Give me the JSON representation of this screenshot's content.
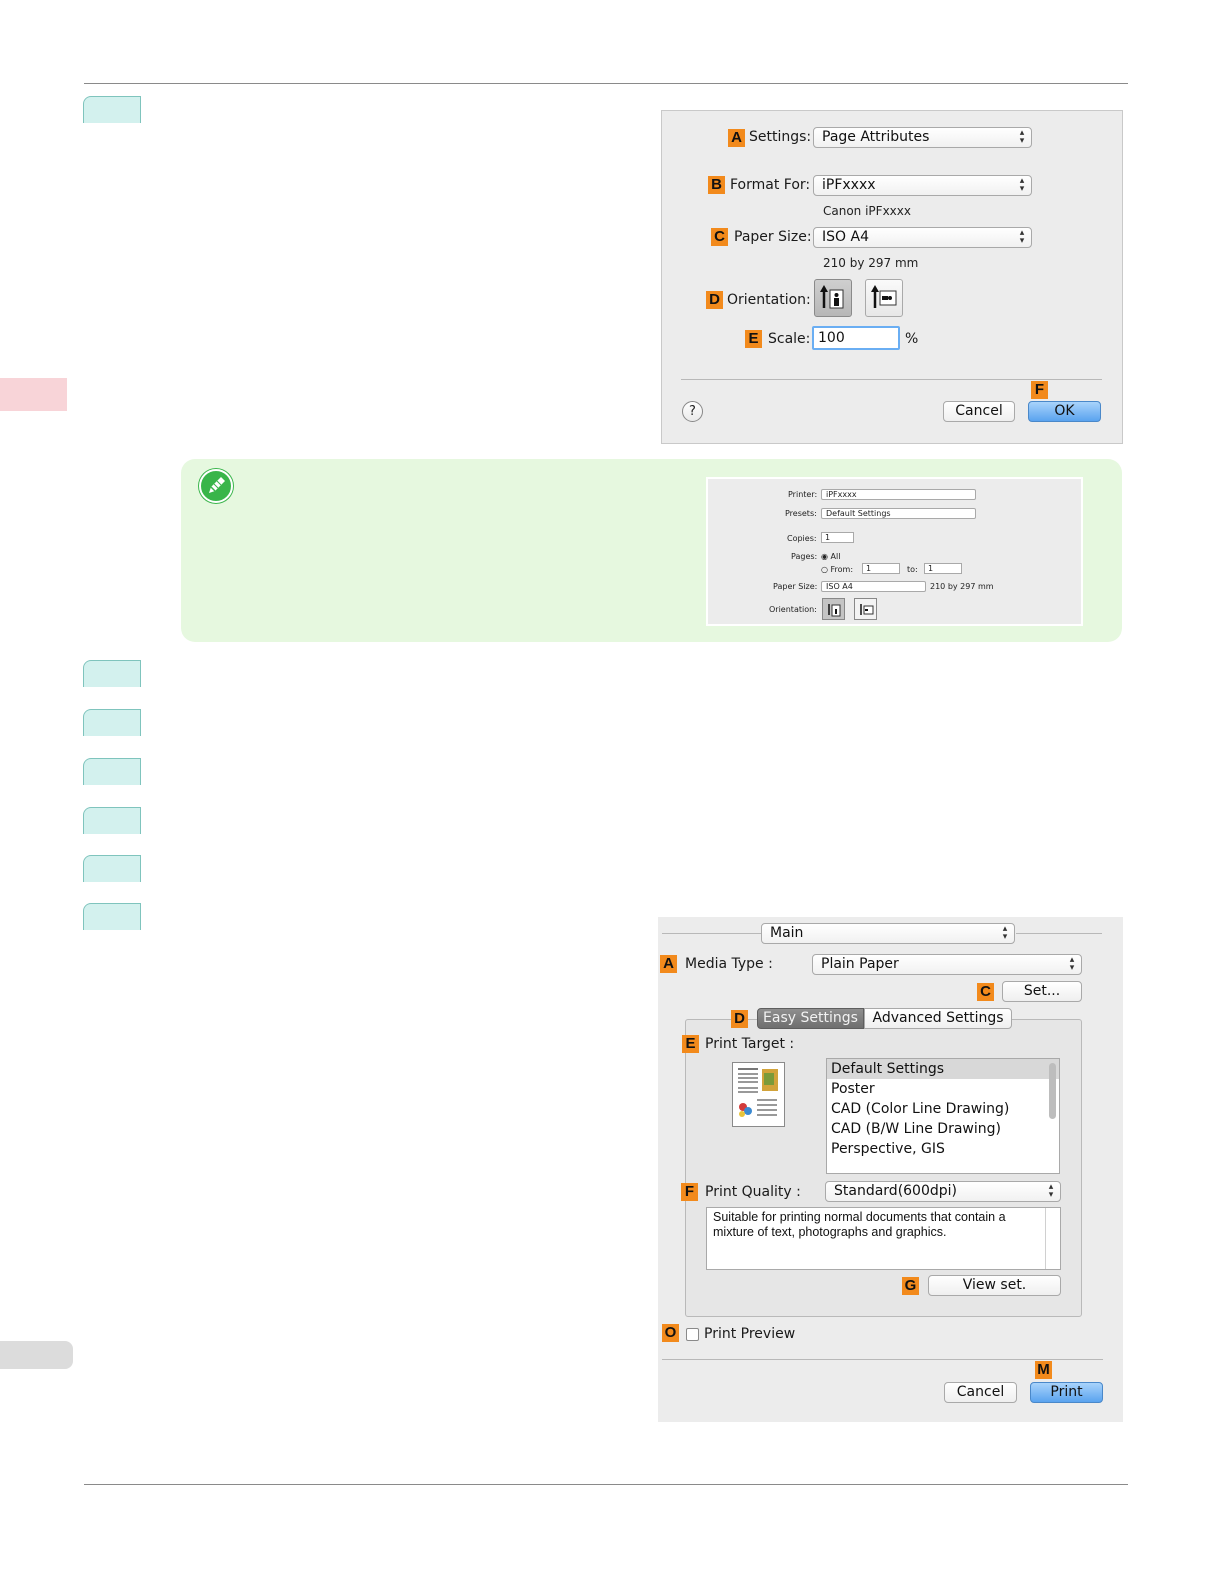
{
  "page_setup": {
    "settings_label": "Settings:",
    "settings_value": "Page Attributes",
    "format_for_label": "Format For:",
    "format_for_value": "iPFxxxx",
    "format_for_sub": "Canon iPFxxxx",
    "paper_size_label": "Paper Size:",
    "paper_size_value": "ISO A4",
    "paper_size_sub": "210 by 297 mm",
    "orientation_label": "Orientation:",
    "scale_label": "Scale:",
    "scale_value": "100",
    "scale_unit": "%",
    "help": "?",
    "cancel": "Cancel",
    "ok": "OK",
    "badges": {
      "a": "A",
      "b": "B",
      "c": "C",
      "d": "D",
      "e": "E",
      "f": "F"
    }
  },
  "note_dialog": {
    "printer_label": "Printer:",
    "printer_value": "iPFxxxx",
    "presets_label": "Presets:",
    "presets_value": "Default Settings",
    "copies_label": "Copies:",
    "copies_value": "1",
    "pages_label": "Pages:",
    "pages_all": "All",
    "pages_from": "From:",
    "from_value": "1",
    "to_label": "to:",
    "to_value": "1",
    "paper_size_label": "Paper Size:",
    "paper_size_value": "ISO A4",
    "paper_size_sub": "210 by 297 mm",
    "orientation_label": "Orientation:"
  },
  "print_dialog": {
    "panel_value": "Main",
    "media_type_label": "Media Type :",
    "media_type_value": "Plain Paper",
    "set_button": "Set...",
    "tabs": [
      "Easy Settings",
      "Advanced Settings"
    ],
    "print_target_label": "Print Target :",
    "print_targets": [
      "Default Settings",
      "Poster",
      "CAD (Color Line Drawing)",
      "CAD (B/W Line Drawing)",
      "Perspective, GIS"
    ],
    "print_quality_label": "Print Quality :",
    "print_quality_value": "Standard(600dpi)",
    "description": "Suitable for printing normal documents that contain a mixture of text, photographs and graphics.",
    "view_set_button": "View set.",
    "print_preview_label": "Print Preview",
    "cancel": "Cancel",
    "print": "Print",
    "badges": {
      "a": "A",
      "c": "C",
      "d": "D",
      "e": "E",
      "f": "F",
      "g": "G",
      "o": "O",
      "m": "M"
    }
  },
  "colors": {
    "badge": "#f28a1c",
    "note_bg": "#e6f8df",
    "step_tab": "#d3f1ee",
    "side_tab": "#f8d4d8",
    "default_button": "#5aa3ef"
  }
}
